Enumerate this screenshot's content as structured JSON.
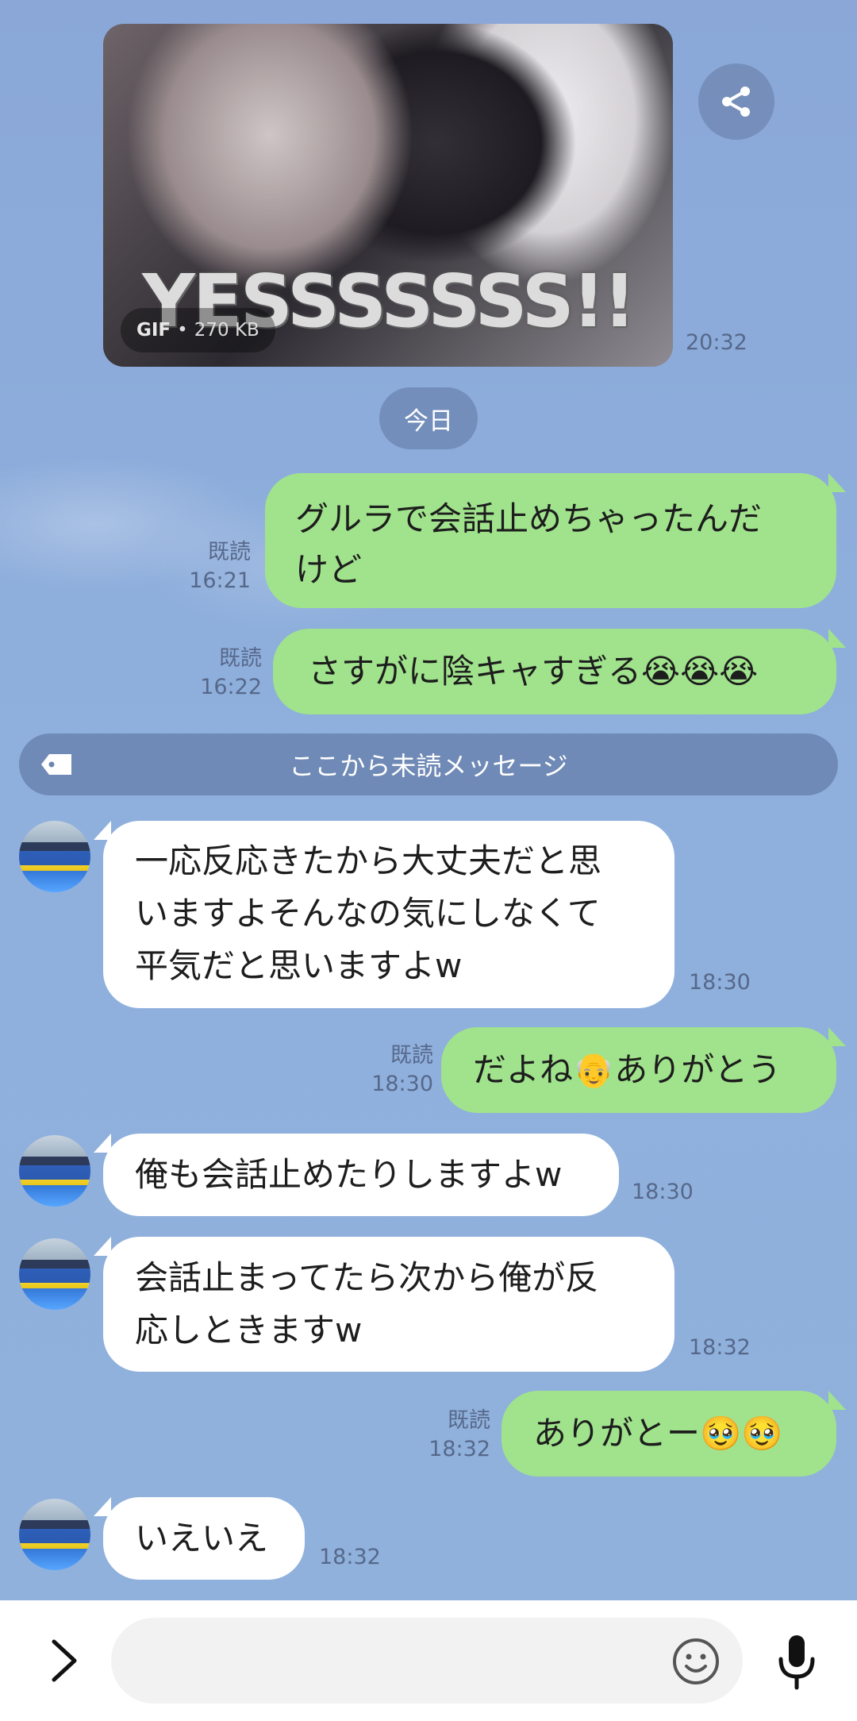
{
  "gif": {
    "badge_type": "GIF",
    "size": "270 KB",
    "overlay_text": "YESSSSSSS!!",
    "time": "20:32"
  },
  "date_chip": "今日",
  "unread_label": "ここから未読メッセージ",
  "messages": [
    {
      "dir": "out",
      "read": "既読",
      "time": "16:21",
      "lines": [
        "グルラで会話止めちゃったんだ",
        "けど"
      ]
    },
    {
      "dir": "out",
      "read": "既読",
      "time": "16:22",
      "text": "さすがに陰キャすぎる😭😭😭"
    },
    {
      "dir": "in",
      "time": "18:30",
      "lines": [
        "一応反応きたから大丈夫だと思",
        "いますよそんなの気にしなくて",
        "平気だと思いますよw"
      ]
    },
    {
      "dir": "out",
      "read": "既読",
      "time": "18:30",
      "text": "だよね👴ありがとう"
    },
    {
      "dir": "in",
      "time": "18:30",
      "text": "俺も会話止めたりしますよw"
    },
    {
      "dir": "in",
      "time": "18:32",
      "lines": [
        "会話止まってたら次から俺が反",
        "応しときますw"
      ]
    },
    {
      "dir": "out",
      "read": "既読",
      "time": "18:32",
      "text": "ありがとー🥹🥹"
    },
    {
      "dir": "in",
      "time": "18:32",
      "text": "いえいえ"
    }
  ],
  "icons": {
    "share": "share-icon",
    "tag": "tag-icon",
    "expand": "chevron-right-icon",
    "emoji": "emoji-icon",
    "mic": "microphone-icon"
  },
  "colors": {
    "outgoing_bubble": "#a0e38c",
    "incoming_bubble": "#ffffff",
    "background": "#8fb0dd"
  }
}
